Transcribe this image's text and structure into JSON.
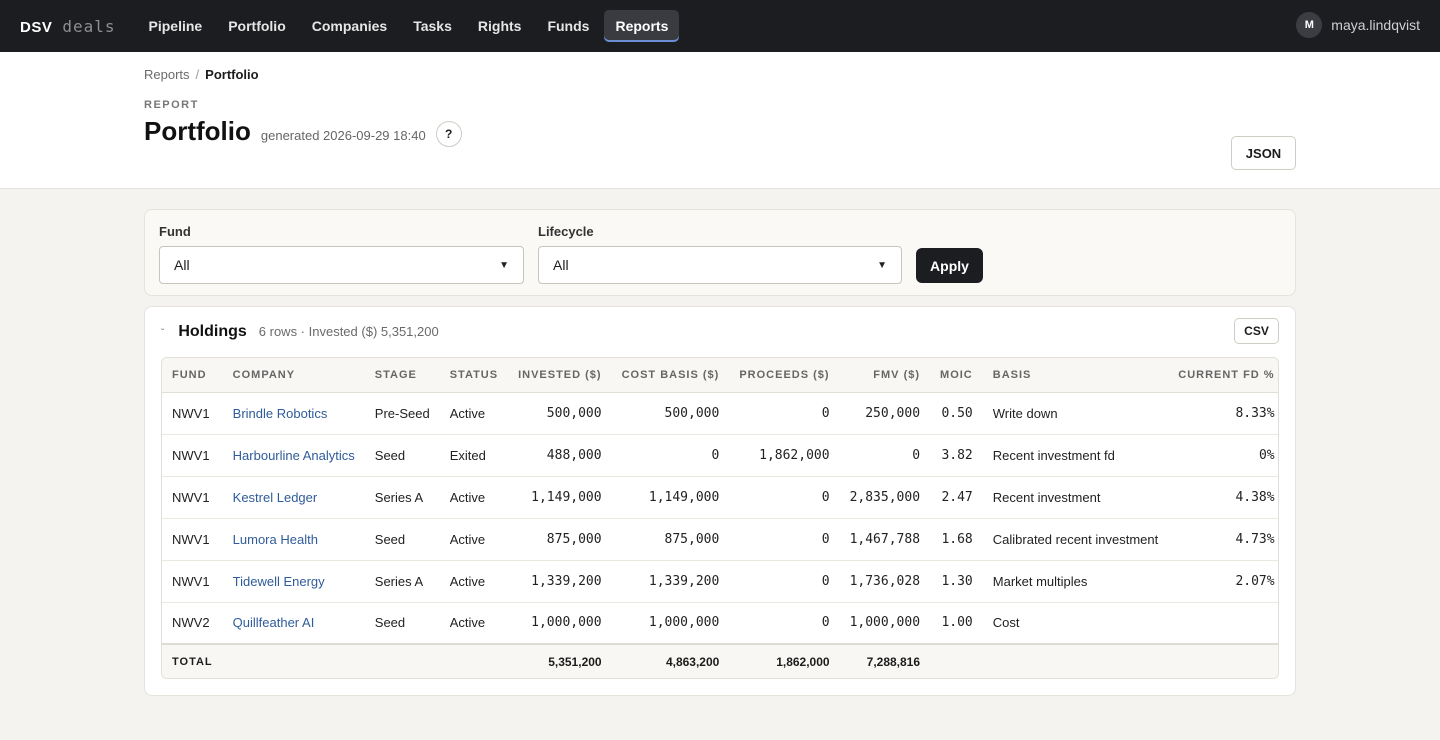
{
  "app": {
    "brand_strong": "DSV",
    "brand_light": "deals"
  },
  "nav": [
    {
      "label": "Pipeline",
      "active": false
    },
    {
      "label": "Portfolio",
      "active": false
    },
    {
      "label": "Companies",
      "active": false
    },
    {
      "label": "Tasks",
      "active": false
    },
    {
      "label": "Rights",
      "active": false
    },
    {
      "label": "Funds",
      "active": false
    },
    {
      "label": "Reports",
      "active": true
    }
  ],
  "user": {
    "initial": "M",
    "name": "maya.lindqvist"
  },
  "breadcrumb": {
    "parent": "Reports",
    "separator": "/",
    "current": "Portfolio"
  },
  "page": {
    "eyebrow": "REPORT",
    "title": "Portfolio",
    "generated": "generated 2026-09-29 18:40",
    "help_label": "?",
    "json_label": "JSON"
  },
  "filters": {
    "fund": {
      "label": "Fund",
      "value": "All"
    },
    "lifecycle": {
      "label": "Lifecycle",
      "value": "All"
    },
    "apply_label": "Apply"
  },
  "holdings": {
    "title": "Holdings",
    "meta": "6 rows · Invested ($) 5,351,200",
    "csv_label": "CSV",
    "columns": [
      "FUND",
      "COMPANY",
      "STAGE",
      "STATUS",
      "INVESTED ($)",
      "COST BASIS ($)",
      "PROCEEDS ($)",
      "FMV ($)",
      "MOIC",
      "BASIS",
      "CURRENT FD %"
    ],
    "rows": [
      {
        "fund": "NWV1",
        "company": "Brindle Robotics",
        "stage": "Pre-Seed",
        "status": "Active",
        "invested": "500,000",
        "cost_basis": "500,000",
        "proceeds": "0",
        "fmv": "250,000",
        "moic": "0.50",
        "basis": "Write down",
        "fd": "8.33%"
      },
      {
        "fund": "NWV1",
        "company": "Harbourline Analytics",
        "stage": "Seed",
        "status": "Exited",
        "invested": "488,000",
        "cost_basis": "0",
        "proceeds": "1,862,000",
        "fmv": "0",
        "moic": "3.82",
        "basis": "Recent investment fd",
        "fd": "0%"
      },
      {
        "fund": "NWV1",
        "company": "Kestrel Ledger",
        "stage": "Series A",
        "status": "Active",
        "invested": "1,149,000",
        "cost_basis": "1,149,000",
        "proceeds": "0",
        "fmv": "2,835,000",
        "moic": "2.47",
        "basis": "Recent investment",
        "fd": "4.38%"
      },
      {
        "fund": "NWV1",
        "company": "Lumora Health",
        "stage": "Seed",
        "status": "Active",
        "invested": "875,000",
        "cost_basis": "875,000",
        "proceeds": "0",
        "fmv": "1,467,788",
        "moic": "1.68",
        "basis": "Calibrated recent investment",
        "fd": "4.73%"
      },
      {
        "fund": "NWV1",
        "company": "Tidewell Energy",
        "stage": "Series A",
        "status": "Active",
        "invested": "1,339,200",
        "cost_basis": "1,339,200",
        "proceeds": "0",
        "fmv": "1,736,028",
        "moic": "1.30",
        "basis": "Market multiples",
        "fd": "2.07%"
      },
      {
        "fund": "NWV2",
        "company": "Quillfeather AI",
        "stage": "Seed",
        "status": "Active",
        "invested": "1,000,000",
        "cost_basis": "1,000,000",
        "proceeds": "0",
        "fmv": "1,000,000",
        "moic": "1.00",
        "basis": "Cost",
        "fd": ""
      }
    ],
    "total": {
      "label": "TOTAL",
      "invested": "5,351,200",
      "cost_basis": "4,863,200",
      "proceeds": "1,862,000",
      "fmv": "7,288,816"
    }
  }
}
